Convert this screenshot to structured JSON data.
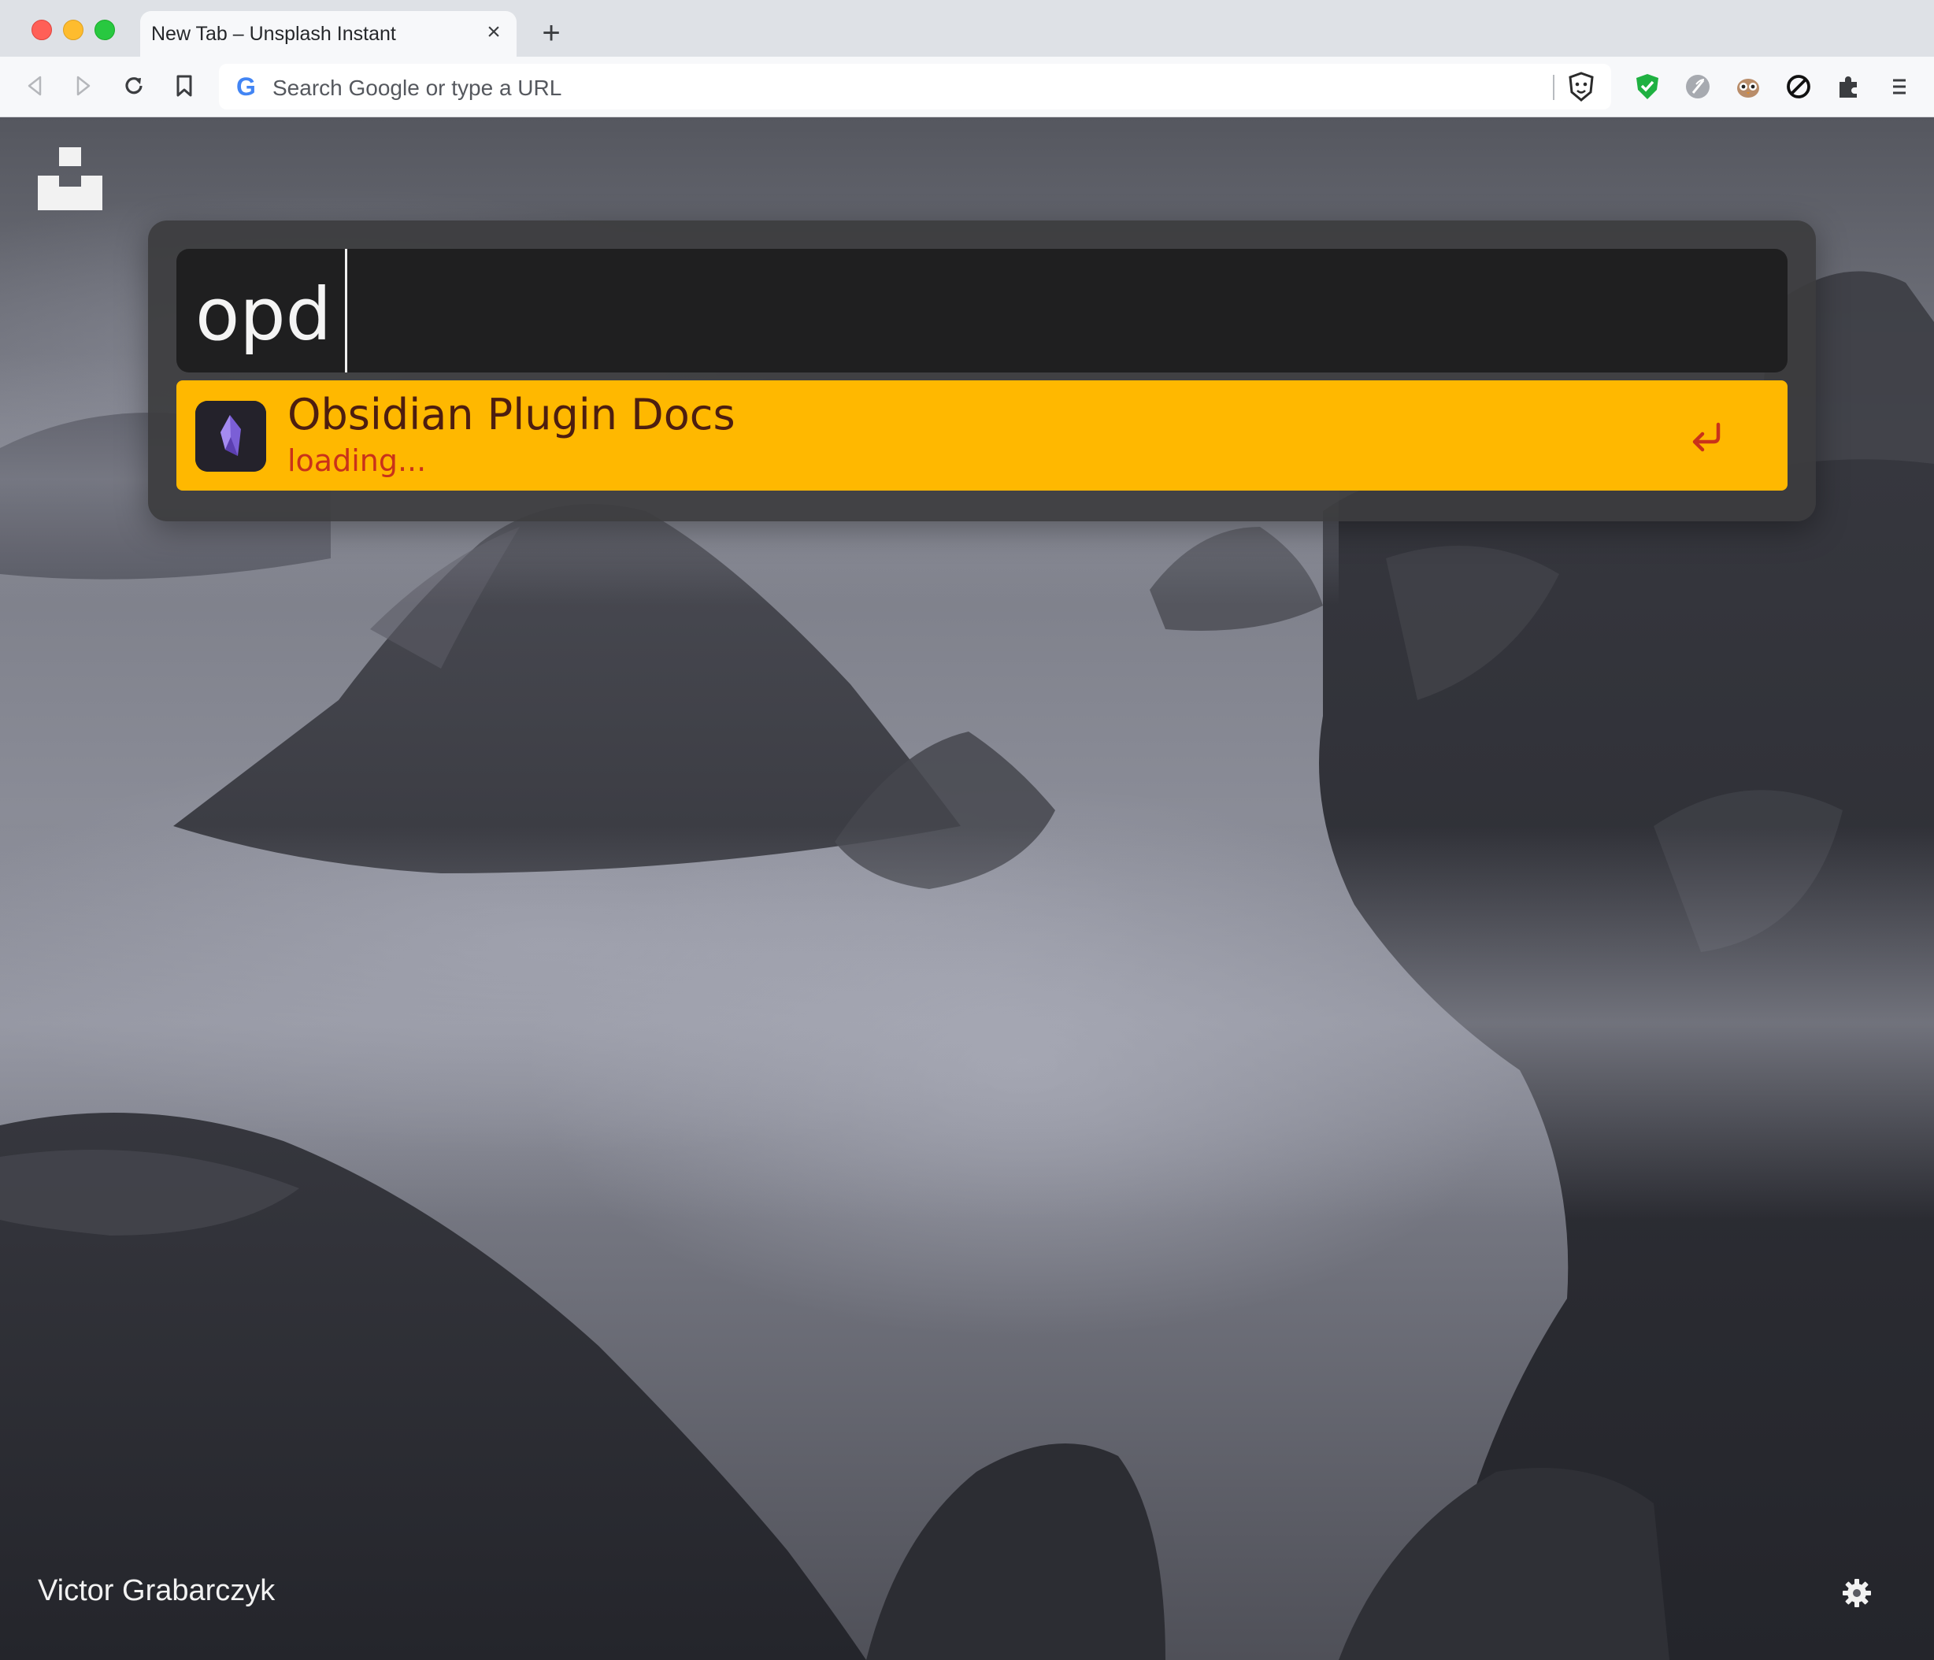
{
  "browser": {
    "tab_title": "New Tab – Unsplash Instant",
    "tab_close": "×",
    "new_tab": "+",
    "omnibox_placeholder": "Search Google or type a URL",
    "omnibox_logo": "G",
    "nav_icons": [
      "back-icon",
      "forward-icon",
      "reload-icon",
      "bookmark-icon"
    ],
    "extension_icons": [
      "brave-shield-icon",
      "check-shield-icon",
      "feather-icon",
      "owl-icon",
      "block-icon",
      "puzzle-icon",
      "menu-icon"
    ]
  },
  "launcher": {
    "query": "opd",
    "results": [
      {
        "title": "Obsidian Plugin Docs",
        "subtitle": "loading...",
        "icon": "obsidian-icon"
      }
    ],
    "enter_icon": "return-arrow-icon"
  },
  "photo": {
    "credit": "Victor Grabarczyk"
  },
  "colors": {
    "highlight": "#ffb800",
    "result_title": "#4d1e10",
    "result_subtitle": "#c9321a",
    "search_box": "#1f1f20"
  }
}
